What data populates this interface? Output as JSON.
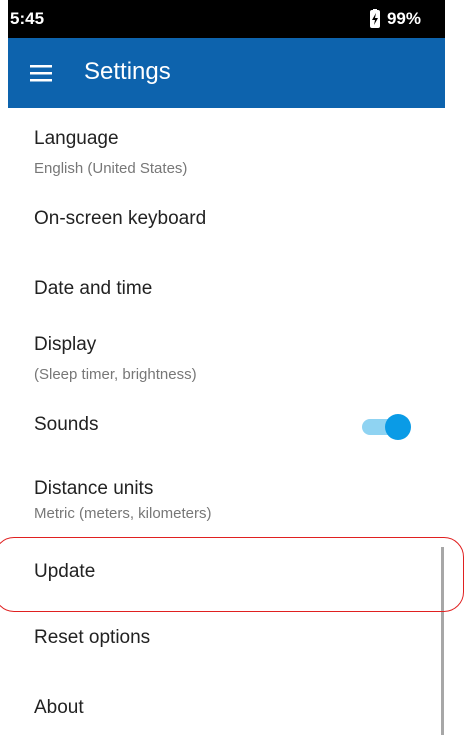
{
  "status_bar": {
    "time": "5:45",
    "battery": "99%",
    "battery_icon": "battery-charging-icon"
  },
  "app_bar": {
    "menu_icon": "hamburger-menu-icon",
    "title": "Settings",
    "color": "#0d63ad"
  },
  "settings": {
    "items": [
      {
        "title": "Language",
        "subtitle": "English (United States)"
      },
      {
        "title": "On-screen keyboard"
      },
      {
        "title": "Date and time"
      },
      {
        "title": "Display",
        "subtitle": "(Sleep timer, brightness)"
      },
      {
        "title": "Sounds",
        "toggle_on": true
      },
      {
        "title": "Distance units",
        "subtitle": "Metric (meters, kilometers)"
      },
      {
        "title": "Update",
        "highlighted": true
      },
      {
        "title": "Reset options"
      },
      {
        "title": "About"
      }
    ]
  },
  "colors": {
    "toggle_thumb": "#0a9be6",
    "toggle_track": "#8fd3f2",
    "highlight_outline": "#e02020"
  }
}
